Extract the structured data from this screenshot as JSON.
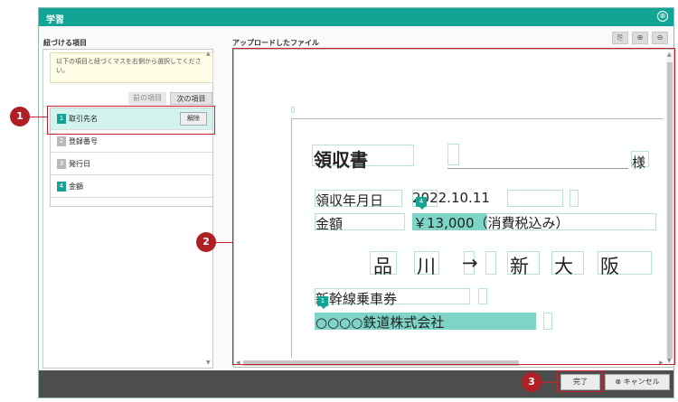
{
  "window": {
    "title": "学習",
    "close_icon": "⊗"
  },
  "left": {
    "heading": "紐づける項目",
    "instruction": "以下の項目と紐づくマスを右側から選択してください。",
    "prev_label": "前の項目",
    "next_label": "次の項目",
    "items": [
      {
        "num": "1",
        "label": "取引先名",
        "active": true,
        "unlink": "解除"
      },
      {
        "num": "2",
        "label": "登録番号",
        "active": false
      },
      {
        "num": "3",
        "label": "発行日",
        "active": false
      },
      {
        "num": "4",
        "label": "金額",
        "active": false
      }
    ]
  },
  "right": {
    "heading": "アップロードしたファイル",
    "toolbar": [
      {
        "name": "fit-page-icon",
        "glyph": "⎘"
      },
      {
        "name": "zoom-in-icon",
        "glyph": "⊕"
      },
      {
        "name": "zoom-out-icon",
        "glyph": "⊖"
      }
    ]
  },
  "document": {
    "title": "領収書",
    "honorific": "様",
    "date_label": "領収年月日",
    "date_value": "2022.10.11",
    "amount_label": "金額",
    "amount_value": "￥13,000（消費税込み）",
    "route": [
      "品",
      "川",
      "→",
      "新",
      "大",
      "阪"
    ],
    "item": "新幹線乗車券",
    "company": "○○○○鉄道株式会社",
    "tag_amount": "4",
    "tag_company": "1"
  },
  "footer": {
    "done_label": "完了",
    "cancel_label": "⊗ キャンセル"
  },
  "callouts": [
    "1",
    "2",
    "3"
  ],
  "colors": {
    "accent": "#12a596",
    "highlight": "#7dd4c7",
    "callout": "#c0252b"
  }
}
